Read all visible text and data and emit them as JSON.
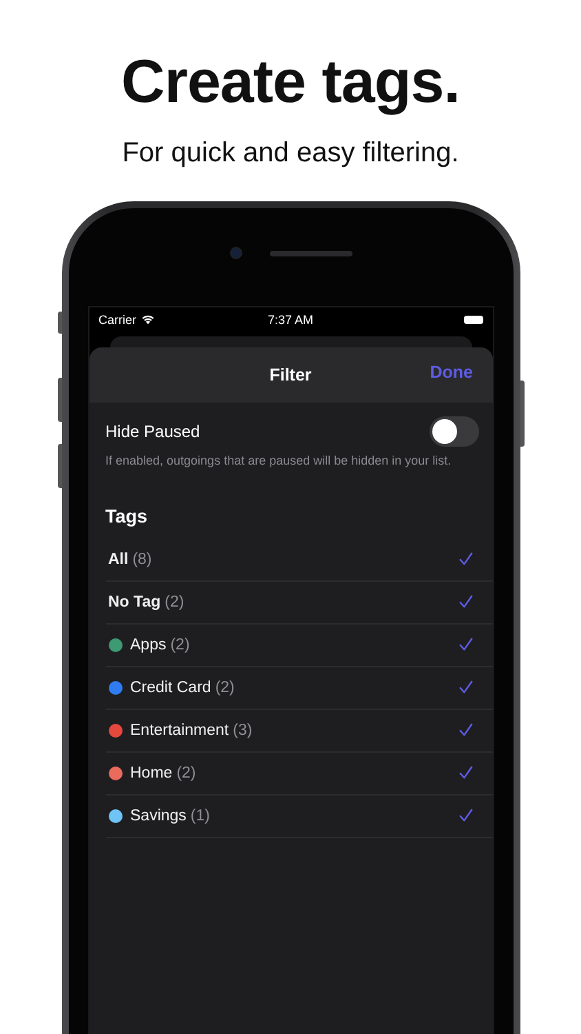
{
  "headline": "Create tags.",
  "subtitle": "For quick and easy filtering.",
  "status_bar": {
    "carrier": "Carrier",
    "time": "7:37 AM"
  },
  "sheet": {
    "title": "Filter",
    "done": "Done"
  },
  "hide_paused": {
    "label": "Hide Paused",
    "on": false,
    "description": "If enabled, outgoings that are paused will be hidden in your list."
  },
  "tags_heading": "Tags",
  "tags": [
    {
      "kind": "special",
      "label": "All",
      "count": "(8)",
      "checked": true
    },
    {
      "kind": "special",
      "label": "No Tag",
      "count": "(2)",
      "checked": true
    },
    {
      "kind": "tag",
      "label": "Apps",
      "count": "(2)",
      "color": "#3d9a73",
      "checked": true
    },
    {
      "kind": "tag",
      "label": "Credit Card",
      "count": "(2)",
      "color": "#2f7bf0",
      "checked": true
    },
    {
      "kind": "tag",
      "label": "Entertainment",
      "count": "(3)",
      "color": "#e5483d",
      "checked": true
    },
    {
      "kind": "tag",
      "label": "Home",
      "count": "(2)",
      "color": "#ea6a5c",
      "checked": true
    },
    {
      "kind": "tag",
      "label": "Savings",
      "count": "(1)",
      "color": "#6fc3f5",
      "checked": true
    }
  ]
}
